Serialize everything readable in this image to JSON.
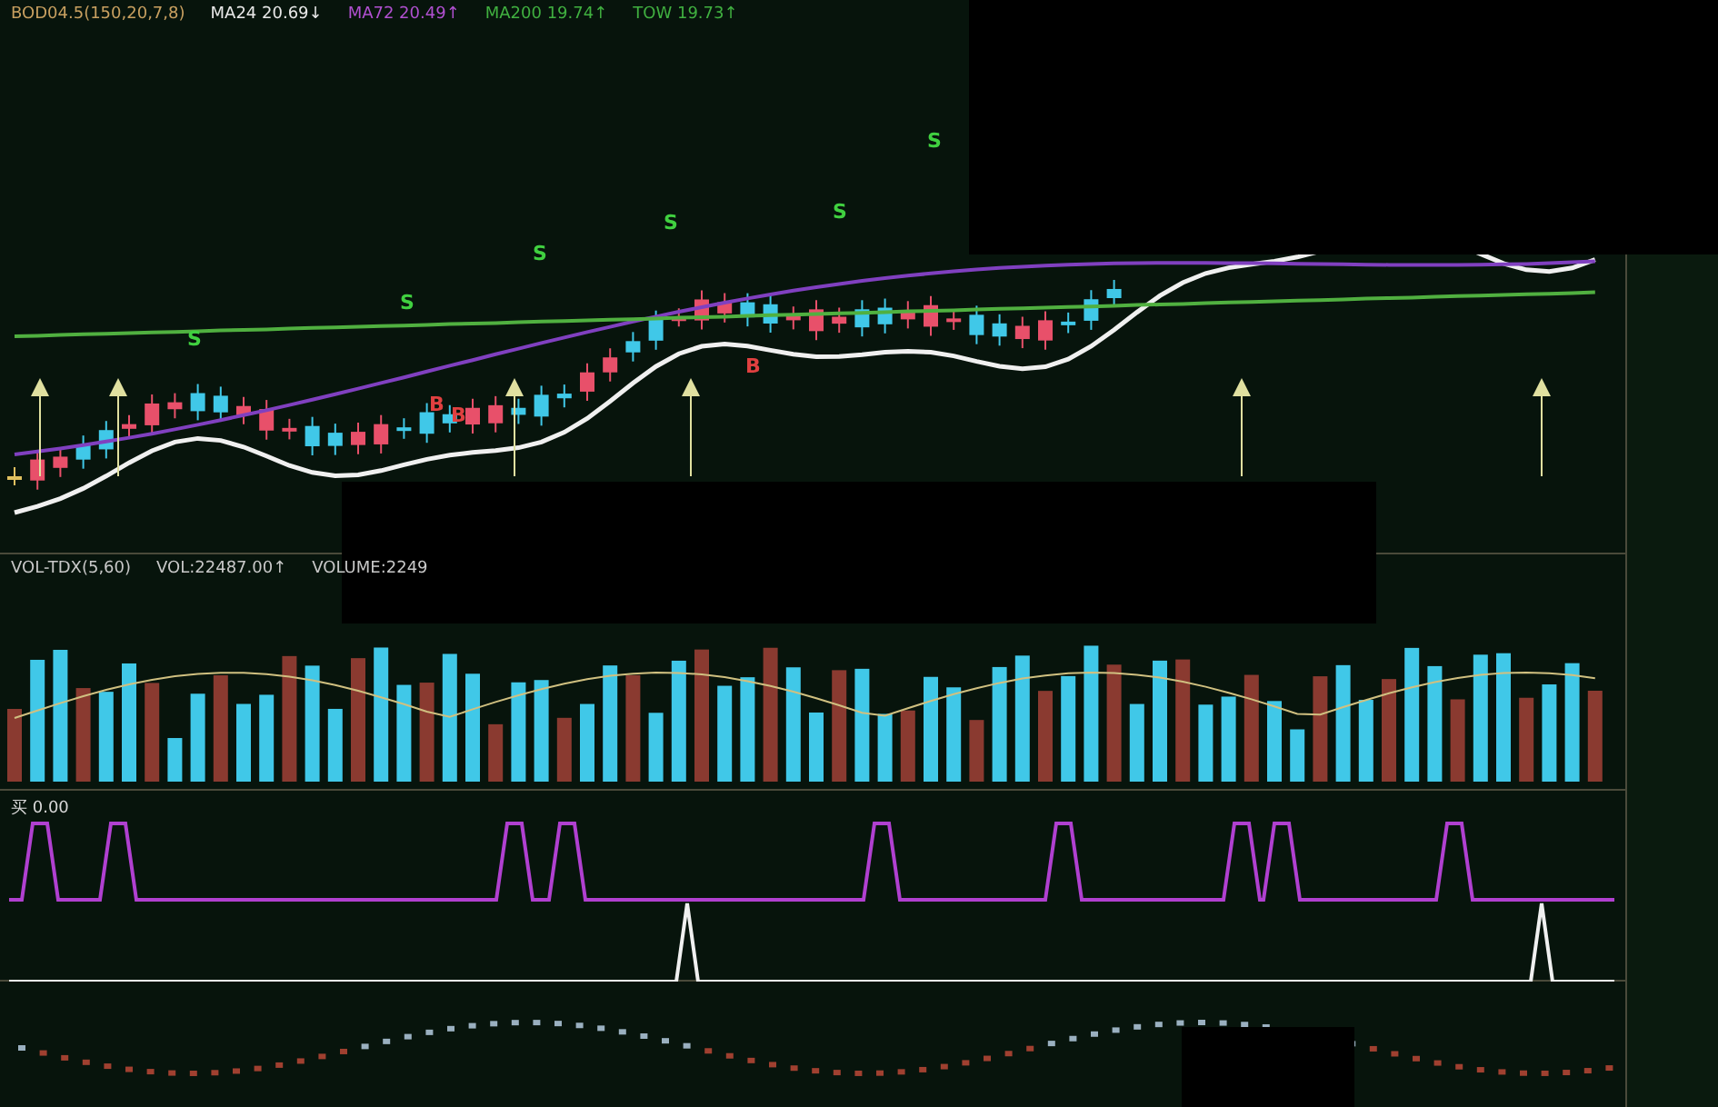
{
  "main_panel": {
    "labels": [
      {
        "text": "BOD04.5(150,20,7,8)",
        "color": "#c8a060"
      },
      {
        "text": "MA24 20.69↓",
        "color": "#e8e8e8"
      },
      {
        "text": "MA72 20.49↑",
        "color": "#b050d0"
      },
      {
        "text": "MA200 19.74↑",
        "color": "#40b040"
      },
      {
        "text": "TOW 19.73↑",
        "color": "#40b040"
      }
    ],
    "signals": [
      {
        "text": "S",
        "kind": "sell"
      },
      {
        "text": "S",
        "kind": "sell"
      },
      {
        "text": "S",
        "kind": "sell"
      },
      {
        "text": "S",
        "kind": "sell"
      },
      {
        "text": "S",
        "kind": "sell"
      },
      {
        "text": "S",
        "kind": "sell"
      },
      {
        "text": "B",
        "kind": "buy"
      },
      {
        "text": "B",
        "kind": "buy"
      },
      {
        "text": "B",
        "kind": "buy"
      }
    ]
  },
  "volume_panel": {
    "labels": [
      {
        "text": "VOL-TDX(5,60)",
        "color": "#c8c8c8"
      },
      {
        "text": "VOL:22487.00↑",
        "color": "#c8c8c8"
      },
      {
        "text": "VOLUME:2249",
        "color": "#c8c8c8"
      }
    ]
  },
  "signal_panel": {
    "labels": [
      {
        "text": "买 0.00",
        "color": "#d8d8d8"
      }
    ]
  }
}
